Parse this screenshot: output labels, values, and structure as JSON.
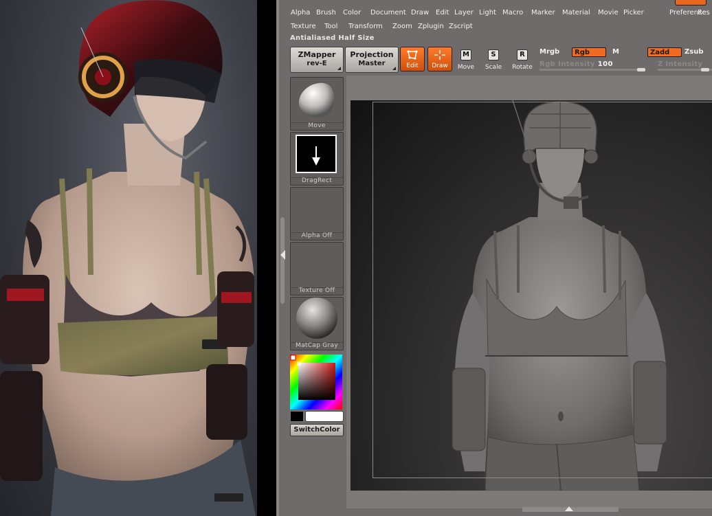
{
  "menus": {
    "row1": [
      "Alpha",
      "Brush",
      "Color",
      "Document",
      "Draw",
      "Edit",
      "Layer",
      "Light",
      "Macro",
      "Marker",
      "Material",
      "Movie",
      "Picker",
      "Preferences",
      "Re"
    ],
    "row2": [
      "Texture",
      "Tool",
      "Transform",
      "Zoom",
      "Zplugin",
      "Zscript"
    ]
  },
  "title_strip": "Antialiased Half Size",
  "toolbar": {
    "zmapper": {
      "line1": "ZMapper",
      "line2": "rev-E"
    },
    "projection_master": {
      "line1": "Projection",
      "line2": "Master"
    },
    "edit_label": "Edit",
    "draw_label": "Draw",
    "move": {
      "key": "M",
      "label": "Move"
    },
    "scale": {
      "key": "S",
      "label": "Scale"
    },
    "rotate": {
      "key": "R",
      "label": "Rotate"
    },
    "mrgb": "Mrgb",
    "rgb": "Rgb",
    "m": "M",
    "zadd": "Zadd",
    "zsub": "Zsub",
    "rgb_intensity_label": "Rgb Intensity",
    "rgb_intensity_value": "100",
    "rgb_intensity_level": 1.0,
    "z_intensity_label": "Z Intensity"
  },
  "shelf": {
    "brush": "Move",
    "stroke": "DragRect",
    "alpha": "Alpha Off",
    "texture": "Texture Off",
    "material": "MatCap Gray",
    "switch_color": "SwitchColor"
  },
  "colors": {
    "ui_bg": "#6e6b6a",
    "accent_orange": "#f06b1f",
    "button_gray": "#c4c1bd",
    "main_color": "#000000",
    "secondary_color": "#ffffff"
  },
  "icons": {
    "edit": "edit-frame-icon",
    "draw": "draw-crosshair-icon",
    "stroke": "drag-arrow-icon"
  }
}
